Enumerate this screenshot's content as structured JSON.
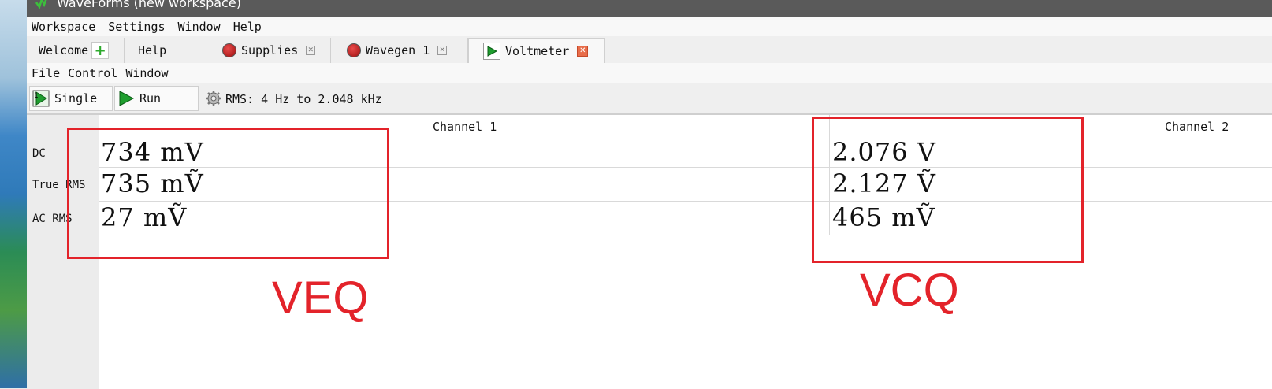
{
  "window": {
    "title": "WaveForms (new workspace)"
  },
  "menubar": {
    "items": [
      "Workspace",
      "Settings",
      "Window",
      "Help"
    ]
  },
  "tabs": [
    {
      "label": "Welcome",
      "icon": "plus-icon"
    },
    {
      "label": "Help"
    },
    {
      "label": "Supplies",
      "icon": "stop-icon",
      "close": "close-icon"
    },
    {
      "label": "Wavegen 1",
      "icon": "stop-icon",
      "close": "close-icon"
    },
    {
      "label": "Voltmeter",
      "icon": "play-icon",
      "close": "close-icon",
      "active": true
    }
  ],
  "submenu": {
    "items": [
      "File",
      "Control",
      "Window"
    ]
  },
  "toolbar": {
    "single_label": "Single",
    "run_label": "Run",
    "rms_text": "RMS: 4 Hz to 2.048 kHz"
  },
  "voltmeter": {
    "row_labels": [
      "DC",
      "True RMS",
      "AC RMS"
    ],
    "channel1": {
      "header": "Channel 1",
      "values": [
        "734 mV",
        "735 mṼ",
        "27 mṼ"
      ]
    },
    "channel2": {
      "header": "Channel 2",
      "values": [
        "2.076 V",
        "2.127 Ṽ",
        "465 mṼ"
      ]
    }
  },
  "annotations": {
    "left_label": "VEQ",
    "right_label": "VCQ",
    "color": "#e3232a"
  }
}
